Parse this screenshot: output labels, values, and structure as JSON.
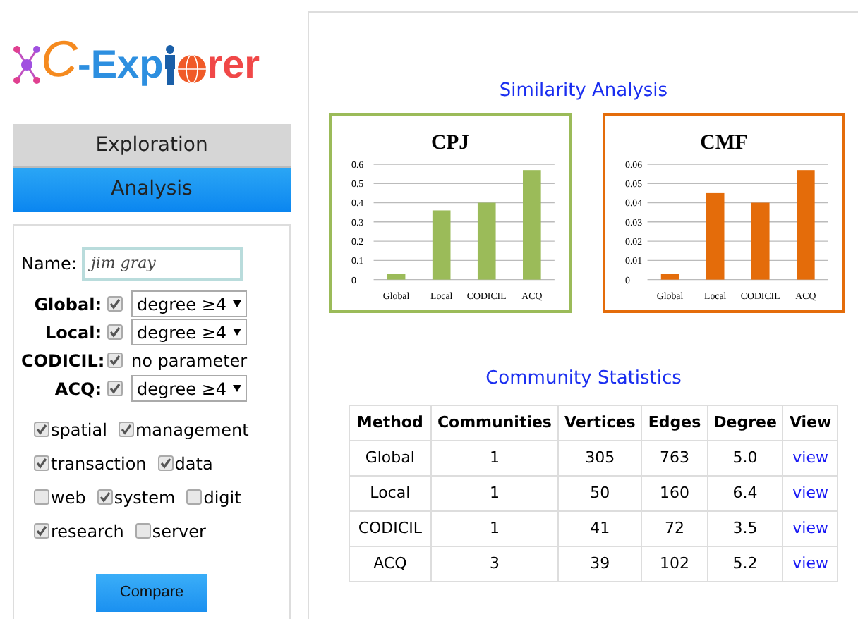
{
  "logo": {
    "prefix": "C",
    "middle": "-Exp",
    "suffix": "rer"
  },
  "nav": [
    {
      "label": "Exploration",
      "selected": false
    },
    {
      "label": "Analysis",
      "selected": true
    }
  ],
  "form": {
    "name": {
      "label": "Name:",
      "value": "jim gray"
    },
    "methods": [
      {
        "label": "Global:",
        "checked": true,
        "kind": "select",
        "value": "degree ≥4"
      },
      {
        "label": "Local:",
        "checked": true,
        "kind": "select",
        "value": "degree ≥4"
      },
      {
        "label": "CODICIL:",
        "checked": true,
        "kind": "text",
        "value": "no parameter"
      },
      {
        "label": "ACQ:",
        "checked": true,
        "kind": "select",
        "value": "degree ≥4"
      }
    ],
    "keywords": [
      [
        {
          "label": "spatial",
          "checked": true
        },
        {
          "label": "management",
          "checked": true
        }
      ],
      [
        {
          "label": "transaction",
          "checked": true
        },
        {
          "label": "data",
          "checked": true
        }
      ],
      [
        {
          "label": "web",
          "checked": false
        },
        {
          "label": "system",
          "checked": true
        },
        {
          "label": "digit",
          "checked": false
        }
      ],
      [
        {
          "label": "research",
          "checked": true
        },
        {
          "label": "server",
          "checked": false
        }
      ]
    ],
    "button": "Compare"
  },
  "similarity": {
    "title": "Similarity Analysis",
    "charts": [
      {
        "chart_data": {
          "type": "bar",
          "title": "CPJ",
          "categories": [
            "Global",
            "Local",
            "CODICIL",
            "ACQ"
          ],
          "grid": true,
          "series": [
            {
              "color": "#9bbb59",
              "values": [
                0.03,
                0.36,
                0.4,
                0.57
              ]
            }
          ],
          "ylim": [
            0,
            0.6
          ],
          "yticks": [
            {
              "value": 0,
              "label": "0"
            },
            {
              "value": 0.1,
              "label": "0.1"
            },
            {
              "value": 0.2,
              "label": "0.2"
            },
            {
              "value": 0.3,
              "label": "0.3"
            },
            {
              "value": 0.4,
              "label": "0.4"
            },
            {
              "value": 0.5,
              "label": "0.5"
            },
            {
              "value": 0.6,
              "label": "0.6"
            }
          ]
        }
      },
      {
        "chart_data": {
          "type": "bar",
          "title": "CMF",
          "categories": [
            "Global",
            "Local",
            "CODICIL",
            "ACQ"
          ],
          "grid": true,
          "series": [
            {
              "color": "#e46c0a",
              "values": [
                0.003,
                0.045,
                0.04,
                0.057
              ]
            }
          ],
          "ylim": [
            0,
            0.06
          ],
          "yticks": [
            {
              "value": 0,
              "label": "0"
            },
            {
              "value": 0.01,
              "label": "0.01"
            },
            {
              "value": 0.02,
              "label": "0.02"
            },
            {
              "value": 0.03,
              "label": "0.03"
            },
            {
              "value": 0.04,
              "label": "0.04"
            },
            {
              "value": 0.05,
              "label": "0.05"
            },
            {
              "value": 0.06,
              "label": "0.06"
            }
          ]
        }
      }
    ]
  },
  "statistics": {
    "title": "Community Statistics",
    "columns": [
      "Method",
      "Communities",
      "Vertices",
      "Edges",
      "Degree",
      "View"
    ],
    "rows": [
      [
        "Global",
        "1",
        "305",
        "763",
        "5.0",
        "view"
      ],
      [
        "Local",
        "1",
        "50",
        "160",
        "6.4",
        "view"
      ],
      [
        "CODICIL",
        "1",
        "41",
        "72",
        "3.5",
        "view"
      ],
      [
        "ACQ",
        "3",
        "39",
        "102",
        "5.2",
        "view"
      ]
    ]
  }
}
